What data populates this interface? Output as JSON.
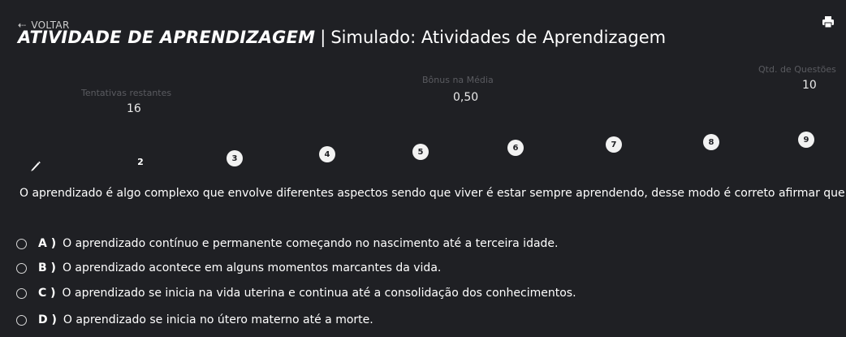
{
  "header": {
    "back_label": "VOLTAR",
    "title_bold": "ATIVIDADE DE APRENDIZAGEM",
    "title_sep": "|",
    "title_rest": "Simulado: Atividades de Aprendizagem",
    "print_icon": "printer-icon"
  },
  "stats": {
    "attempts_label": "Tentativas restantes",
    "attempts_value": "16",
    "bonus_label": "Bônus na Média",
    "bonus_value": "0,50",
    "questions_label": "Qtd. de Questões",
    "questions_value": "10"
  },
  "nav": {
    "current_icon": "pencil-icon",
    "items": [
      "2",
      "3",
      "4",
      "5",
      "6",
      "7",
      "8",
      "9"
    ]
  },
  "question": {
    "text": "O aprendizado é algo complexo que envolve diferentes aspectos sendo que viver é estar sempre aprendendo, desse modo é correto afirmar que:",
    "options": [
      {
        "letter": "A )",
        "text": "O aprendizado contínuo e permanente começando no nascimento até a terceira idade."
      },
      {
        "letter": "B )",
        "text": "O aprendizado acontece em alguns momentos marcantes da vida."
      },
      {
        "letter": "C )",
        "text": "O aprendizado se inicia na vida uterina e continua até a consolidação dos conhecimentos."
      },
      {
        "letter": "D )",
        "text": "O aprendizado se inicia no útero materno até a morte."
      }
    ]
  }
}
